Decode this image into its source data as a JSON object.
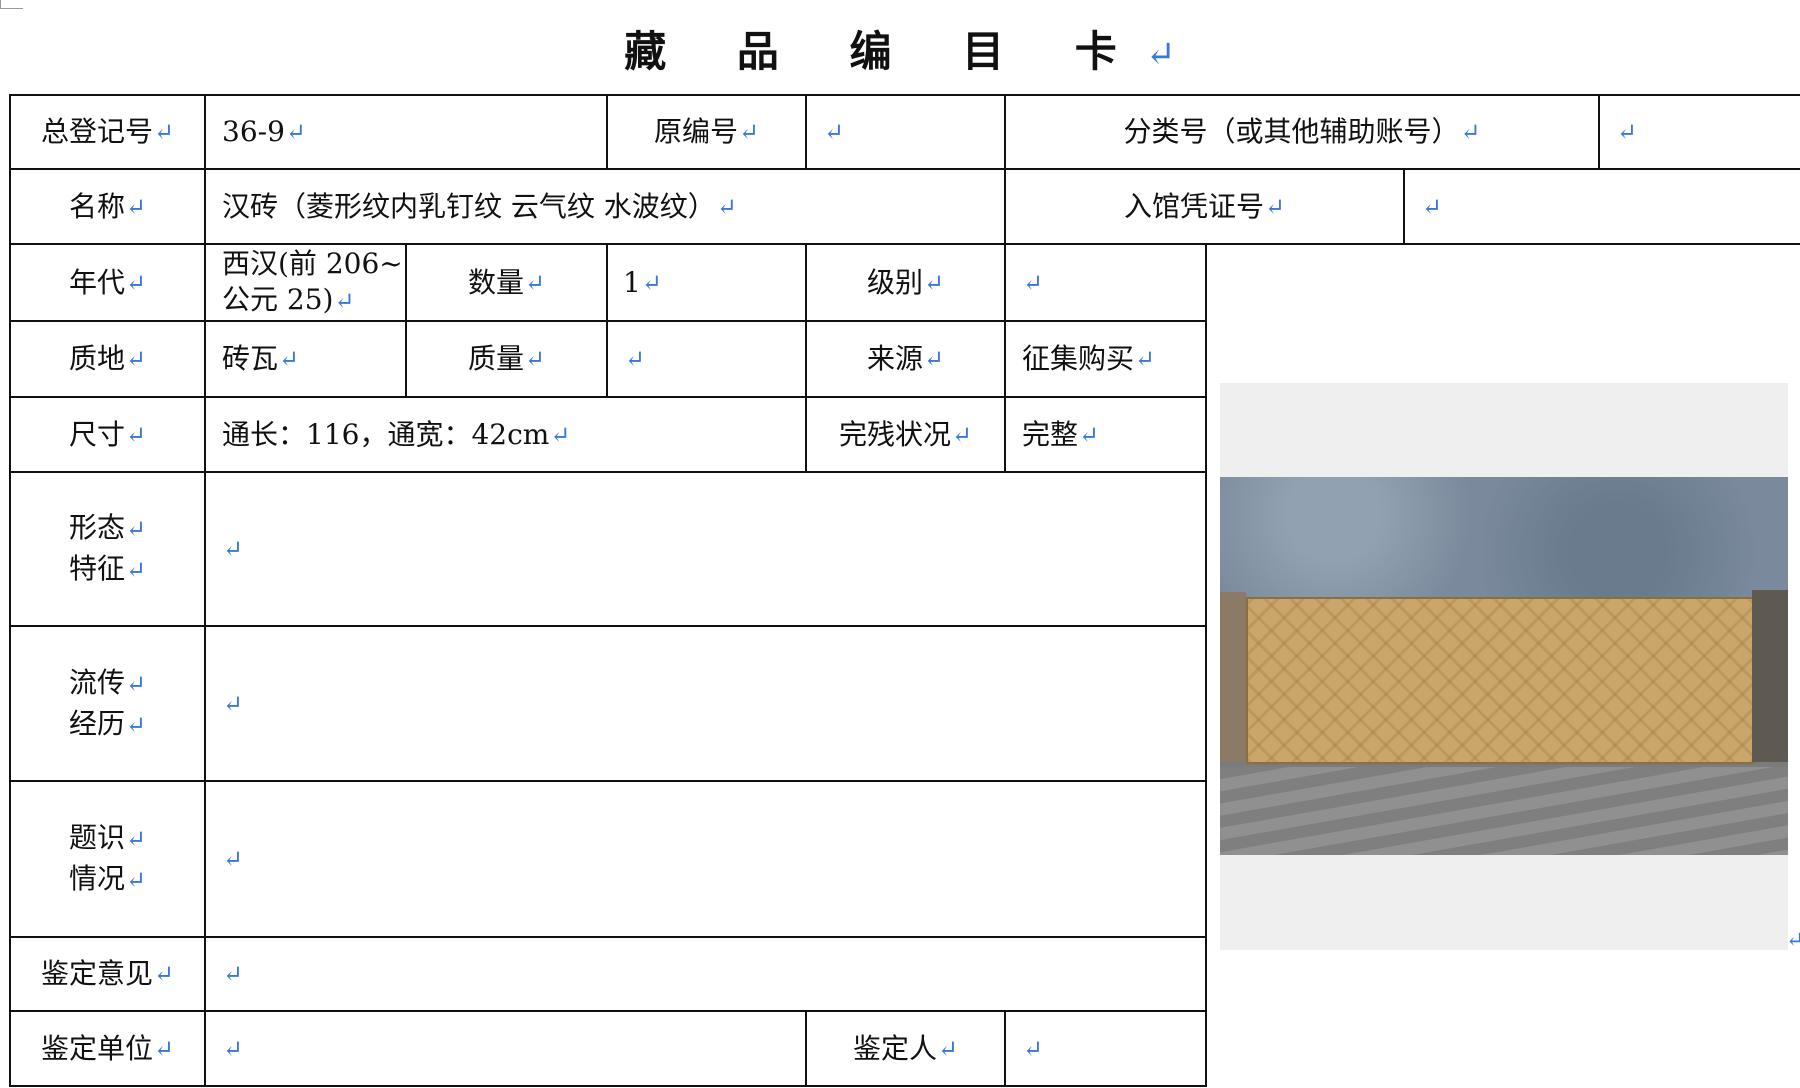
{
  "title": "藏 品 编 目 卡",
  "return_mark": "↵",
  "row1": {
    "reg_no_label": "总登记号",
    "reg_no_value": "36-9",
    "orig_no_label": "原编号",
    "orig_no_value": "",
    "class_no_label": "分类号（或其他辅助账号）",
    "class_no_value": ""
  },
  "row2": {
    "name_label": "名称",
    "name_value": "汉砖（菱形纹内乳钉纹 云气纹 水波纹）",
    "voucher_label": "入馆凭证号",
    "voucher_value": ""
  },
  "row3": {
    "era_label": "年代",
    "era_value_line1": "西汉(前 206~",
    "era_value_line2": "公元 25)",
    "qty_label": "数量",
    "qty_value": "1",
    "grade_label": "级别",
    "grade_value": ""
  },
  "row4": {
    "material_label": "质地",
    "material_value": "砖瓦",
    "weight_label": "质量",
    "weight_value": "",
    "source_label": "来源",
    "source_value": "征集购买"
  },
  "row5": {
    "size_label": "尺寸",
    "size_value": "通长：116，通宽：42cm",
    "condition_label": "完残状况",
    "condition_value": "完整"
  },
  "row6": {
    "label_line1": "形态",
    "label_line2": "特征",
    "value": ""
  },
  "row7": {
    "label_line1": "流传",
    "label_line2": "经历",
    "value": ""
  },
  "row8": {
    "label_line1": "题识",
    "label_line2": "情况",
    "value": ""
  },
  "row9": {
    "label": "鉴定意见",
    "value": ""
  },
  "row10": {
    "unit_label": "鉴定单位",
    "unit_value": "",
    "appraiser_label": "鉴定人",
    "appraiser_value": ""
  },
  "colors": {
    "border": "#111111",
    "return_mark": "#3a78d8"
  }
}
